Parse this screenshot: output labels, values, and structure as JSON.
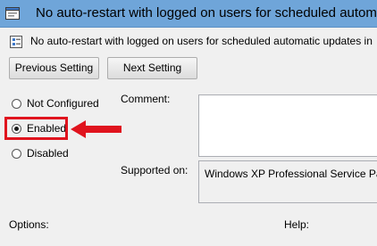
{
  "window": {
    "title": "No auto-restart with logged on users for scheduled autom"
  },
  "header": {
    "policy_name": "No auto-restart with logged on users for scheduled automatic updates in"
  },
  "toolbar": {
    "previous_label": "Previous Setting",
    "next_label": "Next Setting"
  },
  "state_options": [
    {
      "label": "Not Configured",
      "selected": false
    },
    {
      "label": "Enabled",
      "selected": true
    },
    {
      "label": "Disabled",
      "selected": false
    }
  ],
  "labels": {
    "comment": "Comment:",
    "supported_on": "Supported on:",
    "options": "Options:",
    "help": "Help:"
  },
  "supported_on_value": "Windows XP Professional Service Pac",
  "comment_value": "",
  "colors": {
    "titlebar": "#6fa5d9",
    "highlight": "#e0141e"
  }
}
